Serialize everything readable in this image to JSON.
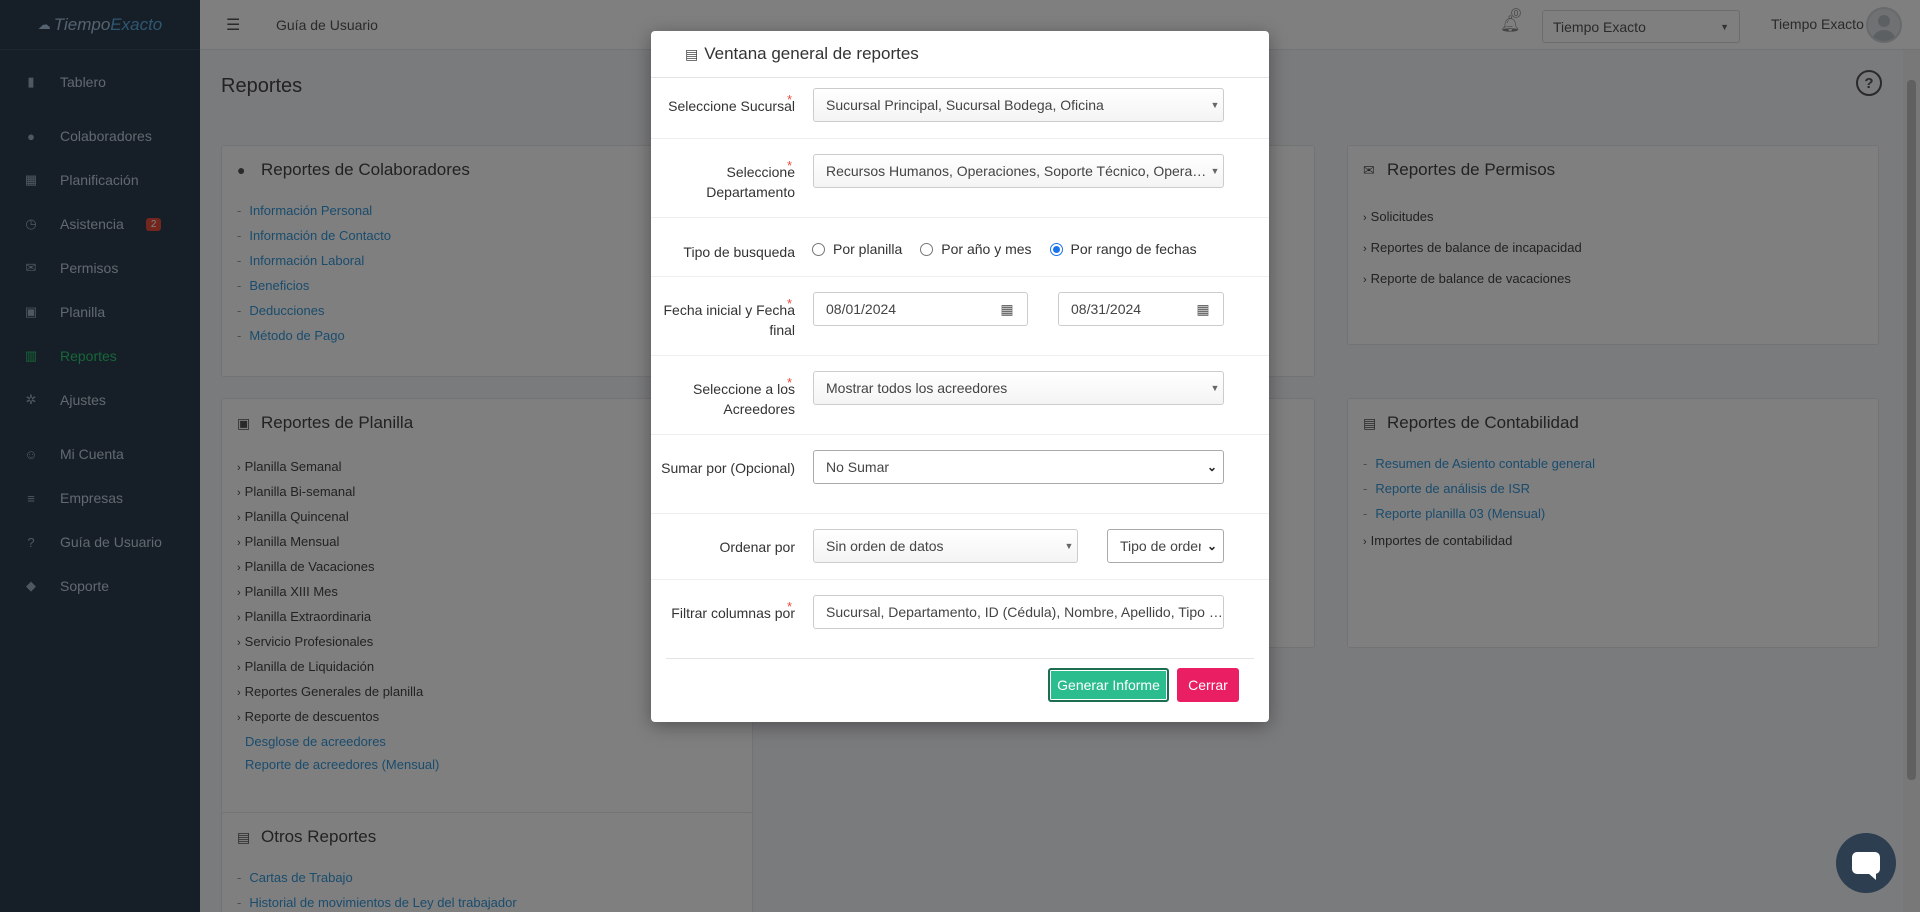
{
  "app": {
    "logo_prefix": "Tiempo",
    "logo_suffix": "Exacto"
  },
  "sidebar": {
    "items": [
      {
        "label": "Tablero",
        "icon": "chart-icon"
      },
      {
        "label": "Colaboradores",
        "icon": "users-icon"
      },
      {
        "label": "Planificación",
        "icon": "calendar-icon"
      },
      {
        "label": "Asistencia",
        "icon": "clock-icon",
        "badge": "2"
      },
      {
        "label": "Permisos",
        "icon": "inbox-icon"
      },
      {
        "label": "Planilla",
        "icon": "money-icon"
      },
      {
        "label": "Reportes",
        "icon": "report-icon",
        "active": true
      },
      {
        "label": "Ajustes",
        "icon": "gear-icon"
      },
      {
        "label": "Mi Cuenta",
        "icon": "user-icon"
      },
      {
        "label": "Empresas",
        "icon": "sliders-icon"
      },
      {
        "label": "Guía de Usuario",
        "icon": "question-icon"
      },
      {
        "label": "Soporte",
        "icon": "shield-icon"
      }
    ]
  },
  "topbar": {
    "guide_label": "Guía de Usuario",
    "notification_count": "0",
    "company_selected": "Tiempo Exacto",
    "user_name": "Tiempo Exacto"
  },
  "page": {
    "title": "Reportes"
  },
  "cards": {
    "colaboradores": {
      "title": "Reportes de Colaboradores",
      "items": [
        "Información Personal",
        "Información de Contacto",
        "Información Laboral",
        "Beneficios",
        "Deducciones",
        "Método de Pago"
      ]
    },
    "permisos": {
      "title": "Reportes de Permisos",
      "items": [
        "Solicitudes",
        "Reportes de balance de incapacidad",
        "Reporte de balance de vacaciones"
      ]
    },
    "planilla": {
      "title": "Reportes de Planilla",
      "items": [
        "Planilla Semanal",
        "Planilla Bi-semanal",
        "Planilla Quincenal",
        "Planilla Mensual",
        "Planilla de Vacaciones",
        "Planilla XIII Mes",
        "Planilla Extraordinaria",
        "Servicio Profesionales",
        "Planilla de Liquidación",
        "Reportes Generales de planilla",
        "Reporte de descuentos"
      ],
      "sub_items": [
        "Desglose de acreedores",
        "Reporte de acreedores (Mensual)"
      ]
    },
    "contabilidad": {
      "title": "Reportes de Contabilidad",
      "links": [
        "Resumen de Asiento contable general",
        "Reporte de análisis de ISR",
        "Reporte planilla 03 (Mensual)"
      ],
      "plain": "Importes de contabilidad"
    },
    "otros": {
      "title": "Otros Reportes",
      "items": [
        "Cartas de Trabajo",
        "Historial de movimientos de Ley del trabajador"
      ]
    }
  },
  "modal": {
    "title": "Ventana general de reportes",
    "sucursal": {
      "label": "Seleccione Sucursal",
      "value": "Sucursal Principal, Sucursal Bodega, Oficina"
    },
    "departamento": {
      "label": "Seleccione Departamento",
      "value": "Recursos Humanos, Operaciones, Soporte Técnico, Operaciones Logísticas"
    },
    "tipo_busqueda": {
      "label": "Tipo de busqueda",
      "options": [
        "Por planilla",
        "Por año y mes",
        "Por rango de fechas"
      ],
      "selected": "Por rango de fechas"
    },
    "fechas": {
      "label": "Fecha inicial y Fecha final",
      "start": "08/01/2024",
      "end": "08/31/2024"
    },
    "acreedores": {
      "label": "Seleccione a los Acreedores",
      "value": "Mostrar todos los acreedores"
    },
    "sumar_por": {
      "label": "Sumar por (Opcional)",
      "value": "No Sumar"
    },
    "ordenar_por": {
      "label": "Ordenar por",
      "value": "Sin orden de datos",
      "order_type": "Tipo de orden"
    },
    "filtrar": {
      "label": "Filtrar columnas por",
      "value": "Sucursal, Departamento, ID (Cédula), Nombre, Apellido, Tipo de acreedor"
    },
    "buttons": {
      "generate": "Generar Informe",
      "close": "Cerrar"
    }
  }
}
